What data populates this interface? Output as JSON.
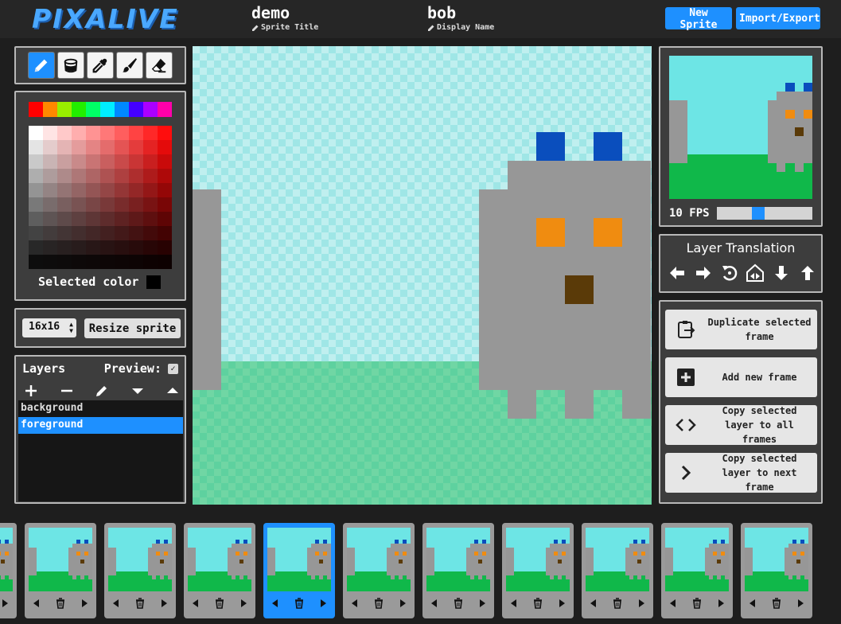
{
  "header": {
    "logo": "PIXALIVE",
    "sprite_title": "demo",
    "sprite_title_label": "Sprite Title",
    "display_name": "bob",
    "display_name_label": "Display Name",
    "new_sprite": "New Sprite",
    "import_export": "Import/Export"
  },
  "tools": [
    {
      "name": "pencil-icon",
      "active": true
    },
    {
      "name": "bucket-icon",
      "active": false
    },
    {
      "name": "eyedropper-icon",
      "active": false
    },
    {
      "name": "brush-icon",
      "active": false
    },
    {
      "name": "eraser-icon",
      "active": false
    }
  ],
  "palette": {
    "hues": [
      "#ff0000",
      "#ff8800",
      "#99ee00",
      "#22ee00",
      "#00ff66",
      "#00eeff",
      "#0088ff",
      "#4400ff",
      "#aa00ff",
      "#ff00aa"
    ],
    "selected_color_label": "Selected color",
    "selected_color": "#000000"
  },
  "resize": {
    "size_value": "16x16",
    "button": "Resize sprite"
  },
  "layers": {
    "title": "Layers",
    "preview_label": "Preview:",
    "preview_checked": true,
    "items": [
      {
        "label": "background",
        "selected": false
      },
      {
        "label": "foreground",
        "selected": true
      }
    ]
  },
  "preview": {
    "fps_label": "10 FPS",
    "fps_fraction": 0.42
  },
  "translation": {
    "title": "Layer Translation",
    "buttons": [
      "left-arrow-icon",
      "right-arrow-icon",
      "rotate-icon",
      "flip-icon",
      "down-arrow-icon",
      "up-arrow-icon"
    ]
  },
  "actions": [
    {
      "icon": "clipboard-icon",
      "label": "Duplicate selected frame"
    },
    {
      "icon": "plus-box-icon",
      "label": "Add new frame"
    },
    {
      "icon": "code-icon",
      "label": "Copy selected layer to all frames"
    },
    {
      "icon": "chevron-right-icon",
      "label": "Copy selected layer to next frame"
    }
  ],
  "frames": {
    "count": 11,
    "selected_index": 4
  },
  "colors": {
    "accent": "#1e90ff",
    "sky": "#6de5e5",
    "grass": "#10b84a",
    "body": "#979797",
    "ears": "#0a4ebd",
    "eyes": "#f08c10",
    "mouth": "#5a3a08"
  }
}
